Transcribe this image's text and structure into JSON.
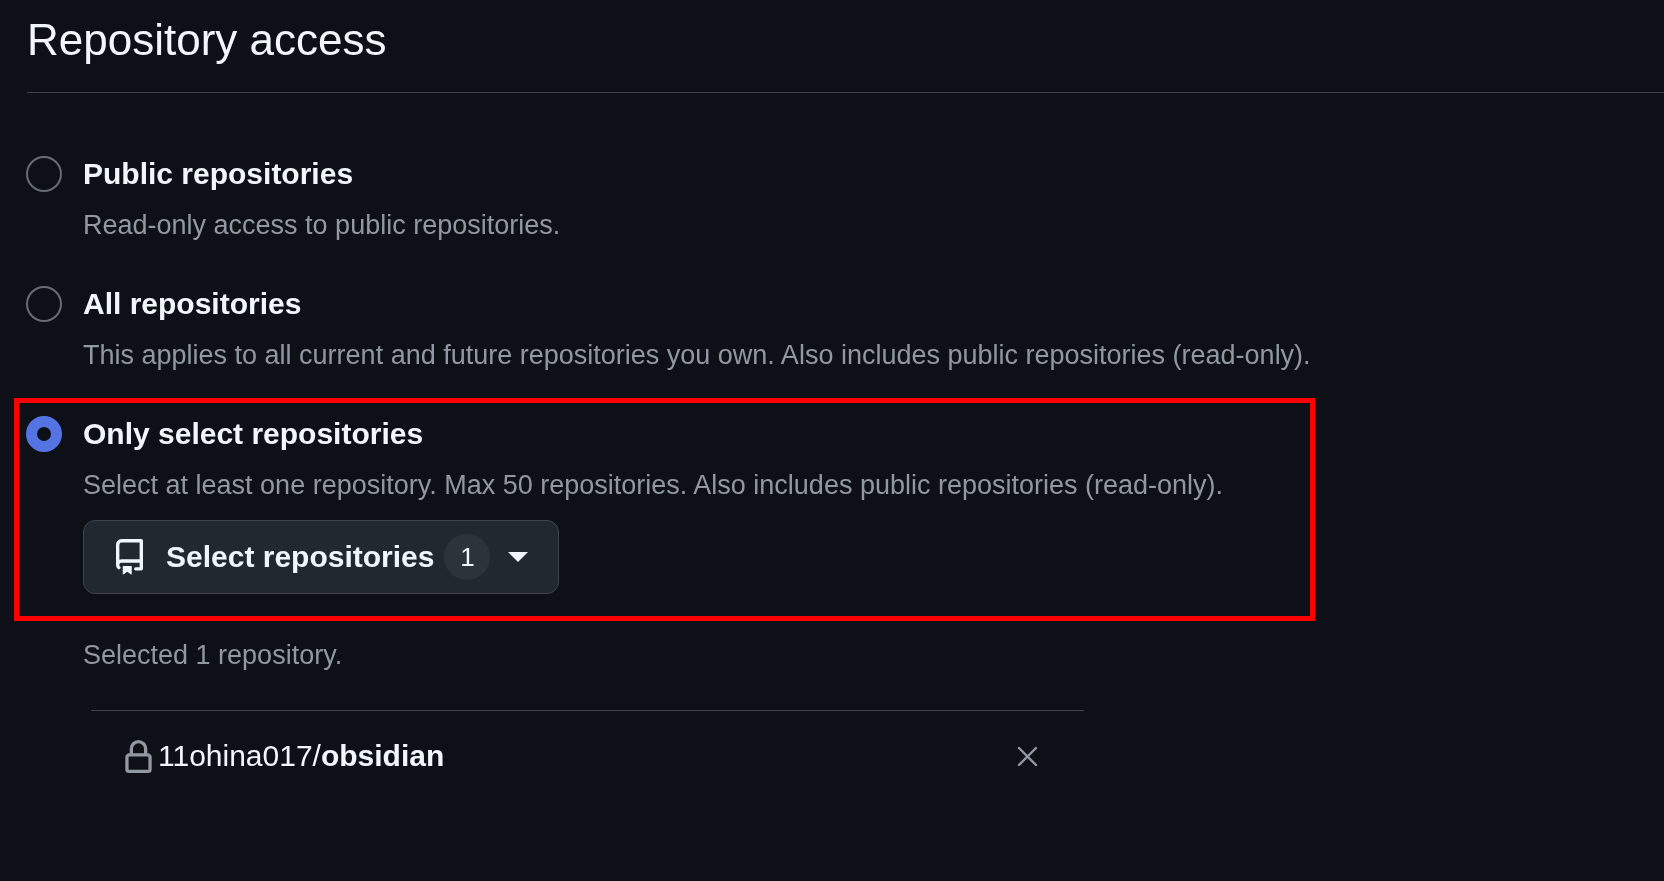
{
  "title": "Repository access",
  "options": [
    {
      "label": "Public repositories",
      "description": "Read-only access to public repositories.",
      "selected": false
    },
    {
      "label": "All repositories",
      "description": "This applies to all current and future repositories you own. Also includes public repositories (read-only).",
      "selected": false
    },
    {
      "label": "Only select repositories",
      "description": "Select at least one repository. Max 50 repositories. Also includes public repositories (read-only).",
      "selected": true,
      "highlighted": true,
      "picker": {
        "label": "Select repositories",
        "count": "1"
      }
    }
  ],
  "selection_summary": "Selected 1 repository.",
  "selected_repositories": [
    {
      "name": "11ohina017/**obsidian**"
    }
  ]
}
